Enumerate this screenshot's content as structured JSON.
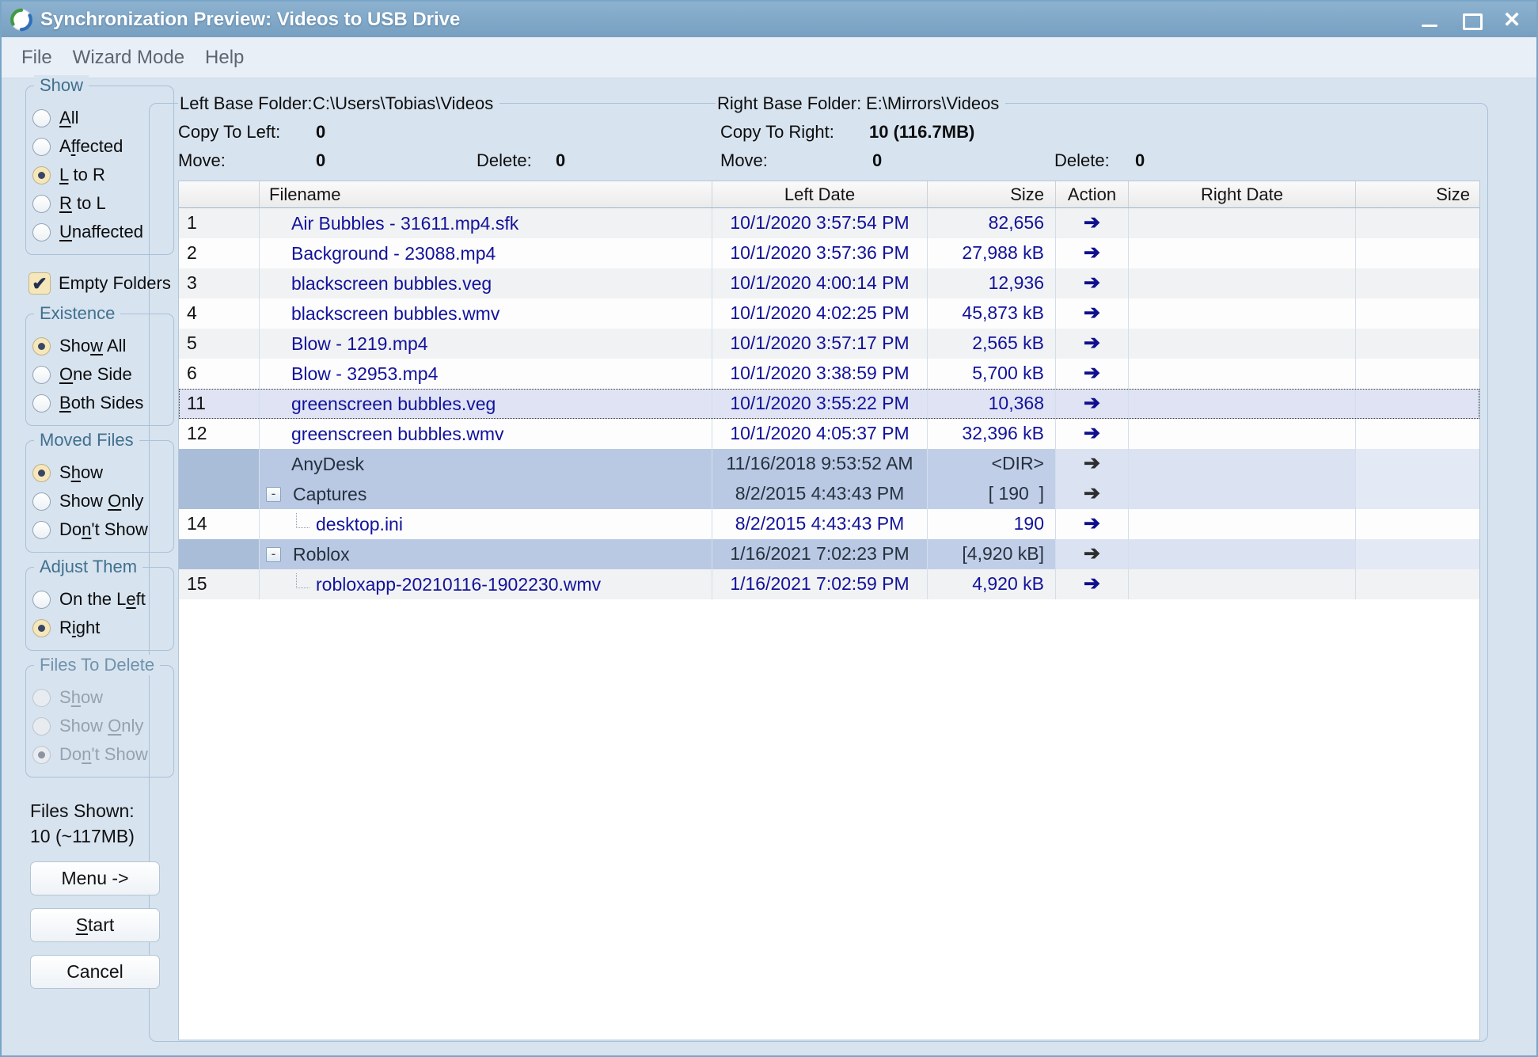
{
  "window": {
    "title": "Synchronization Preview: Videos to USB Drive",
    "icon": "sync-app-icon",
    "colors": {
      "titlebar": "#7fa9c9",
      "panel": "#d7e3ef",
      "selection_bg": "#dfe3f4",
      "dir_row_bg": "#b9c9e4",
      "file_text": "#12129a"
    },
    "icons": {
      "minimize": "minimize-icon",
      "maximize": "maximize-icon",
      "close": "✕",
      "arrow_right": "➔",
      "expander_collapse": "-",
      "check": "✔"
    }
  },
  "menu": {
    "items": [
      "File",
      "Wizard Mode",
      "Help"
    ]
  },
  "info": {
    "left_base_label": "Left Base Folder:",
    "left_base_value": "C:\\Users\\Tobias\\Videos",
    "right_base_label": "Right Base Folder:",
    "right_base_value": "E:\\Mirrors\\Videos",
    "copy_left_label": "Copy To Left:",
    "copy_left_value": "0",
    "copy_right_label": "Copy To Right:",
    "copy_right_value": "10 (116.7MB)",
    "move_left_label": "Move:",
    "move_left_value": "0",
    "delete_left_label": "Delete:",
    "delete_left_value": "0",
    "move_right_label": "Move:",
    "move_right_value": "0",
    "delete_right_label": "Delete:",
    "delete_right_value": "0"
  },
  "sidebar": {
    "groups": [
      {
        "id": "show",
        "label": "Show",
        "disabled": false,
        "options": [
          {
            "pre": "",
            "accel": "A",
            "post": "ll",
            "selected": false
          },
          {
            "pre": "A",
            "accel": "f",
            "post": "fected",
            "selected": false
          },
          {
            "pre": "",
            "accel": "L",
            "post": " to R",
            "selected": true
          },
          {
            "pre": "",
            "accel": "R",
            "post": " to L",
            "selected": false
          },
          {
            "pre": "",
            "accel": "U",
            "post": "naffected",
            "selected": false
          }
        ]
      },
      {
        "id": "existence",
        "label": "Existence",
        "disabled": false,
        "options": [
          {
            "pre": "Sho",
            "accel": "w",
            "post": " All",
            "selected": true
          },
          {
            "pre": "",
            "accel": "O",
            "post": "ne Side",
            "selected": false
          },
          {
            "pre": "",
            "accel": "B",
            "post": "oth Sides",
            "selected": false
          }
        ]
      },
      {
        "id": "moved-files",
        "label": "Moved Files",
        "disabled": false,
        "options": [
          {
            "pre": "S",
            "accel": "h",
            "post": "ow",
            "selected": true
          },
          {
            "pre": "Show ",
            "accel": "O",
            "post": "nly",
            "selected": false
          },
          {
            "pre": "Do",
            "accel": "n",
            "post": "'t Show",
            "selected": false
          }
        ]
      },
      {
        "id": "adjust-them",
        "label": "Adjust Them",
        "disabled": false,
        "options": [
          {
            "pre": "On the L",
            "accel": "e",
            "post": "ft",
            "selected": false
          },
          {
            "pre": "R",
            "accel": "i",
            "post": "ght",
            "selected": true
          }
        ]
      },
      {
        "id": "files-to-delete",
        "label": "Files To Delete",
        "disabled": true,
        "options": [
          {
            "pre": "S",
            "accel": "h",
            "post": "ow",
            "selected": false
          },
          {
            "pre": "Show ",
            "accel": "O",
            "post": "nly",
            "selected": false
          },
          {
            "pre": "Do",
            "accel": "n",
            "post": "'t Show",
            "selected": true
          }
        ]
      }
    ],
    "empty_folders": {
      "label": "Empty Folders",
      "checked": true
    },
    "files_shown_label": "Files Shown:",
    "files_shown_value": "10 (~117MB)",
    "buttons": {
      "menu": {
        "pre": "Menu ->",
        "accel": "",
        "post": ""
      },
      "start": {
        "pre": "",
        "accel": "S",
        "post": "tart"
      },
      "cancel": {
        "pre": "Cancel",
        "accel": "",
        "post": ""
      }
    }
  },
  "table": {
    "headers": [
      "",
      "Filename",
      "Left Date",
      "Size",
      "Action",
      "Right Date",
      "Size"
    ],
    "action_arrow": "➔",
    "rows": [
      {
        "num": "1",
        "name": "Air Bubbles - 31611.mp4.sfk",
        "left_date": "10/1/2020 3:57:54 PM",
        "size": "82,656",
        "right_date": "",
        "right_size": "",
        "kind": "file",
        "expander": false,
        "bg": "stripe"
      },
      {
        "num": "2",
        "name": "Background - 23088.mp4",
        "left_date": "10/1/2020 3:57:36 PM",
        "size": "27,988 kB",
        "right_date": "",
        "right_size": "",
        "kind": "file",
        "expander": false,
        "bg": "plain"
      },
      {
        "num": "3",
        "name": "blackscreen bubbles.veg",
        "left_date": "10/1/2020 4:00:14 PM",
        "size": "12,936",
        "right_date": "",
        "right_size": "",
        "kind": "file",
        "expander": false,
        "bg": "stripe"
      },
      {
        "num": "4",
        "name": "blackscreen bubbles.wmv",
        "left_date": "10/1/2020 4:02:25 PM",
        "size": "45,873 kB",
        "right_date": "",
        "right_size": "",
        "kind": "file",
        "expander": false,
        "bg": "plain"
      },
      {
        "num": "5",
        "name": "Blow - 1219.mp4",
        "left_date": "10/1/2020 3:57:17 PM",
        "size": "2,565 kB",
        "right_date": "",
        "right_size": "",
        "kind": "file",
        "expander": false,
        "bg": "stripe"
      },
      {
        "num": "6",
        "name": "Blow - 32953.mp4",
        "left_date": "10/1/2020 3:38:59 PM",
        "size": "5,700 kB",
        "right_date": "",
        "right_size": "",
        "kind": "file",
        "expander": false,
        "bg": "plain"
      },
      {
        "num": "11",
        "name": "greenscreen bubbles.veg",
        "left_date": "10/1/2020 3:55:22 PM",
        "size": "10,368",
        "right_date": "",
        "right_size": "",
        "kind": "file",
        "expander": false,
        "bg": "selected"
      },
      {
        "num": "12",
        "name": "greenscreen bubbles.wmv",
        "left_date": "10/1/2020 4:05:37 PM",
        "size": "32,396 kB",
        "right_date": "",
        "right_size": "",
        "kind": "file",
        "expander": false,
        "bg": "plain"
      },
      {
        "num": "",
        "name": "AnyDesk",
        "left_date": "11/16/2018 9:53:52 AM",
        "size": "<DIR>",
        "right_date": "",
        "right_size": "",
        "kind": "dir",
        "expander": false,
        "bg": "dir"
      },
      {
        "num": "",
        "name": "Captures",
        "left_date": "8/2/2015 4:43:43 PM",
        "size": "[ 190  ]",
        "right_date": "",
        "right_size": "",
        "kind": "dir",
        "expander": true,
        "bg": "dir"
      },
      {
        "num": "14",
        "name": "desktop.ini",
        "left_date": "8/2/2015 4:43:43 PM",
        "size": "190",
        "right_date": "",
        "right_size": "",
        "kind": "child",
        "expander": false,
        "bg": "plain"
      },
      {
        "num": "",
        "name": "Roblox",
        "left_date": "1/16/2021 7:02:23 PM",
        "size": "[4,920 kB]",
        "right_date": "",
        "right_size": "",
        "kind": "dir",
        "expander": true,
        "bg": "dir"
      },
      {
        "num": "15",
        "name": "robloxapp-20210116-1902230.wmv",
        "left_date": "1/16/2021 7:02:59 PM",
        "size": "4,920 kB",
        "right_date": "",
        "right_size": "",
        "kind": "child",
        "expander": false,
        "bg": "stripe"
      }
    ]
  }
}
